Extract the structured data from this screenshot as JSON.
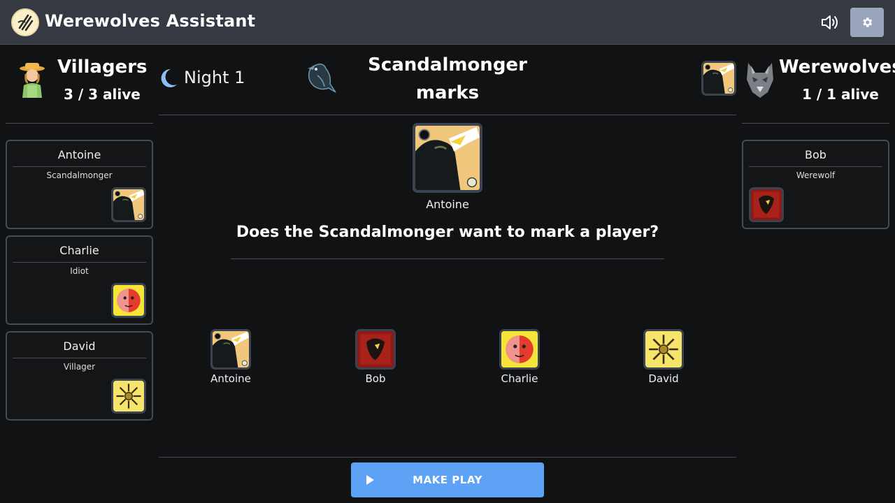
{
  "header": {
    "app_title": "Werewolves Assistant",
    "logo_icon": "werewolf-scratch-logo",
    "sound_icon": "speaker-volume-icon",
    "settings_icon": "gear-icon"
  },
  "villagers": {
    "title": "Villagers",
    "count": "3 / 3 alive",
    "icon": "farmer-icon",
    "players": [
      {
        "name": "Antoine",
        "role": "Scandalmonger",
        "icon": "scandalmonger-card"
      },
      {
        "name": "Charlie",
        "role": "Idiot",
        "icon": "idiot-card"
      },
      {
        "name": "David",
        "role": "Villager",
        "icon": "villager-card"
      }
    ]
  },
  "werewolves": {
    "title": "Werewolves",
    "count": "1 / 1 alive",
    "icon": "wolf-head-icon",
    "players": [
      {
        "name": "Bob",
        "role": "Werewolf",
        "icon": "werewolf-card"
      }
    ]
  },
  "phase": {
    "night_label": "Night 1",
    "moon_icon": "crescent-moon-icon",
    "raven_icon": "raven-icon",
    "title_line1": "Scandalmonger",
    "title_line2": "marks"
  },
  "acting": {
    "player_name": "Antoine"
  },
  "question": "Does the Scandalmonger want to mark a player?",
  "choices": [
    {
      "name": "Antoine",
      "icon": "scandalmonger-card"
    },
    {
      "name": "Bob",
      "icon": "werewolf-card"
    },
    {
      "name": "Charlie",
      "icon": "idiot-card"
    },
    {
      "name": "David",
      "icon": "villager-card"
    }
  ],
  "make_play": {
    "label": "MAKE PLAY",
    "icon": "play-icon"
  },
  "colors": {
    "background": "#111213",
    "header": "#353942",
    "accent_button": "#5da2f5",
    "settings_button": "#9ba6bd",
    "card_border": "#454a55"
  }
}
